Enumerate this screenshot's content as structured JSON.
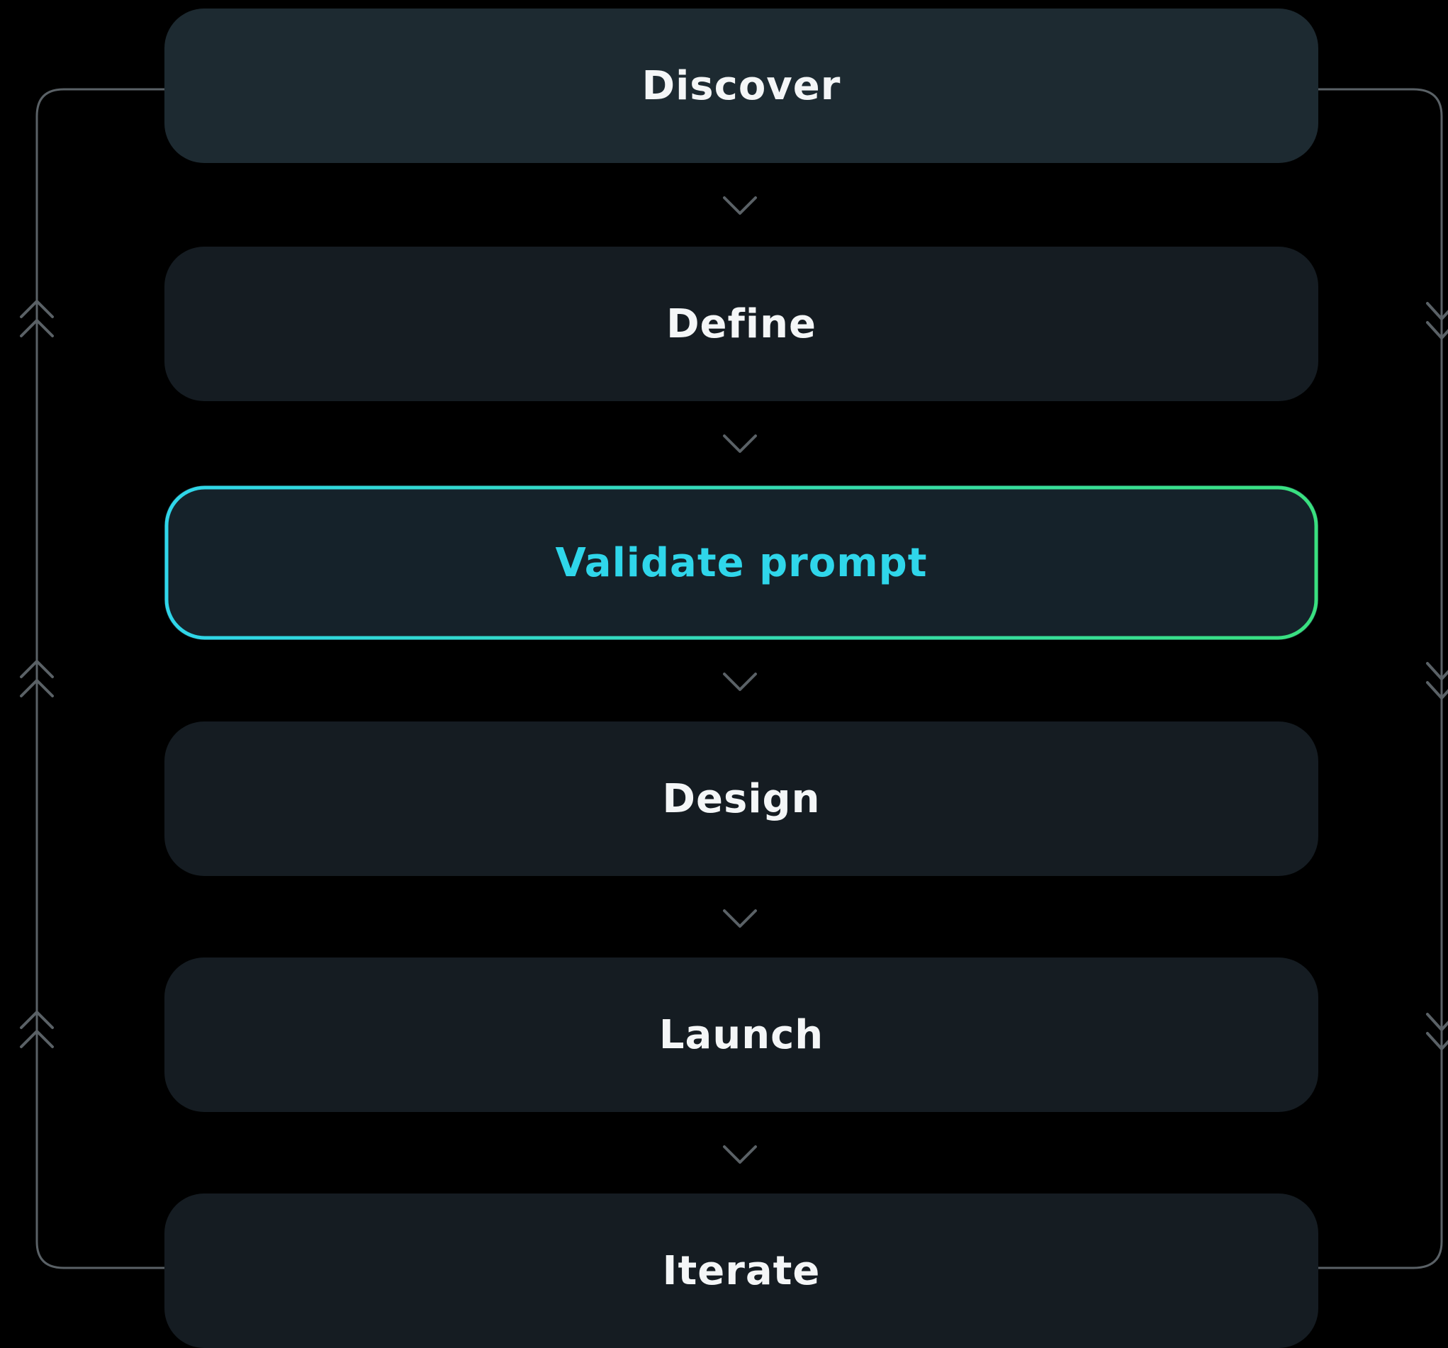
{
  "steps": [
    {
      "label": "Discover"
    },
    {
      "label": "Define"
    },
    {
      "label": "Validate prompt"
    },
    {
      "label": "Design"
    },
    {
      "label": "Launch"
    },
    {
      "label": "Iterate"
    }
  ],
  "active_step": "Validate prompt",
  "colors": {
    "background": "#000000",
    "card": "#151c22",
    "card_first": "#1d2a31",
    "label": "#f4f6f7",
    "active_text": "#2fd6ea",
    "active_border_start": "#2fd6ea",
    "active_border_end": "#39e07f",
    "connector": "#5a6166"
  },
  "icons": {
    "between_steps": "chevron-down-icon",
    "left_loop": "double-chevron-up-icon",
    "right_loop": "double-chevron-down-icon"
  }
}
